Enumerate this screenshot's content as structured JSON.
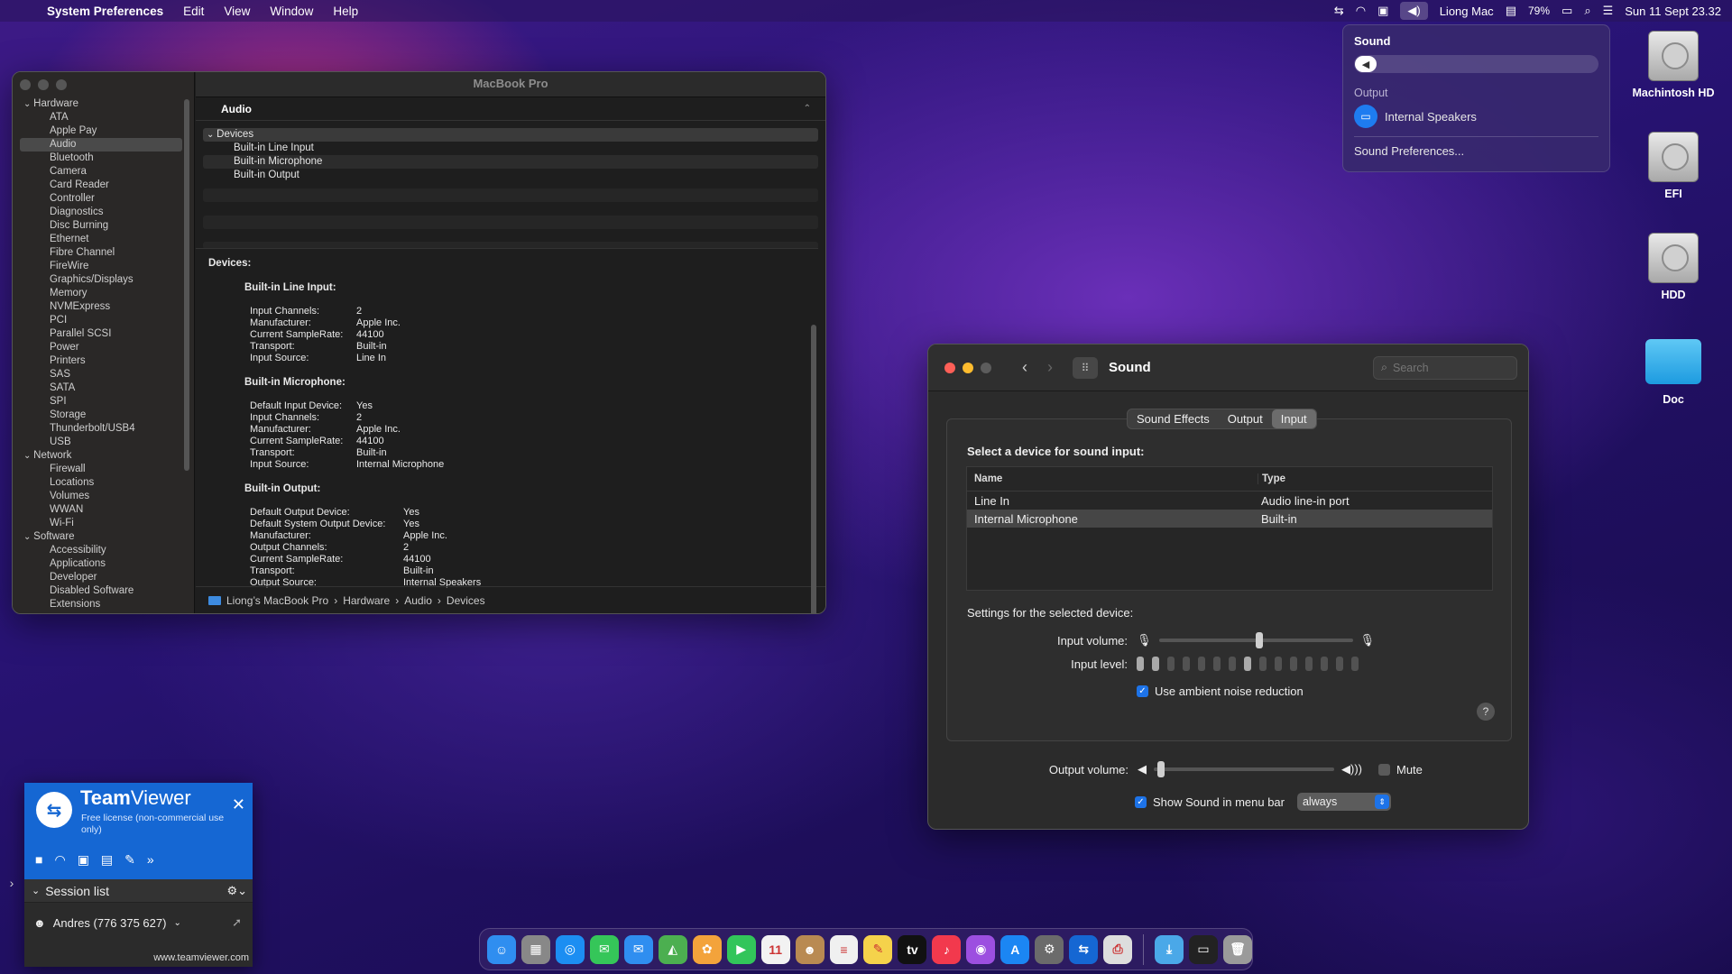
{
  "menubar": {
    "app_name": "System Preferences",
    "menus": [
      "Edit",
      "View",
      "Window",
      "Help"
    ],
    "user": "Liong Mac",
    "battery": "79%",
    "datetime": "Sun 11 Sept  23.32",
    "icons": [
      "apple-icon",
      "teamviewer-icon",
      "wifi-icon",
      "activity-icon",
      "volume-icon",
      "flag-icon",
      "battery-icon",
      "search-icon",
      "control-center-icon"
    ]
  },
  "sound_menu": {
    "title": "Sound",
    "volume_level": 0.02,
    "output_section": "Output",
    "output_device": "Internal Speakers",
    "preferences_link": "Sound Preferences..."
  },
  "desktop_icons": [
    "Machintosh HD",
    "EFI",
    "HDD",
    "Doc"
  ],
  "sysinfo": {
    "window_title": "MacBook Pro",
    "tree": [
      {
        "label": "Hardware",
        "kind": "cat"
      },
      {
        "label": "ATA"
      },
      {
        "label": "Apple Pay"
      },
      {
        "label": "Audio",
        "selected": true
      },
      {
        "label": "Bluetooth"
      },
      {
        "label": "Camera"
      },
      {
        "label": "Card Reader"
      },
      {
        "label": "Controller"
      },
      {
        "label": "Diagnostics"
      },
      {
        "label": "Disc Burning"
      },
      {
        "label": "Ethernet"
      },
      {
        "label": "Fibre Channel"
      },
      {
        "label": "FireWire"
      },
      {
        "label": "Graphics/Displays"
      },
      {
        "label": "Memory"
      },
      {
        "label": "NVMExpress"
      },
      {
        "label": "PCI"
      },
      {
        "label": "Parallel SCSI"
      },
      {
        "label": "Power"
      },
      {
        "label": "Printers"
      },
      {
        "label": "SAS"
      },
      {
        "label": "SATA"
      },
      {
        "label": "SPI"
      },
      {
        "label": "Storage"
      },
      {
        "label": "Thunderbolt/USB4"
      },
      {
        "label": "USB"
      },
      {
        "label": "Network",
        "kind": "cat"
      },
      {
        "label": "Firewall"
      },
      {
        "label": "Locations"
      },
      {
        "label": "Volumes"
      },
      {
        "label": "WWAN"
      },
      {
        "label": "Wi-Fi"
      },
      {
        "label": "Software",
        "kind": "cat"
      },
      {
        "label": "Accessibility"
      },
      {
        "label": "Applications"
      },
      {
        "label": "Developer"
      },
      {
        "label": "Disabled Software"
      },
      {
        "label": "Extensions"
      }
    ],
    "section": "Audio",
    "list_header": "Devices",
    "list_items": [
      "Built-in Line Input",
      "Built-in Microphone",
      "Built-in Output"
    ],
    "detail_heading": "Devices:",
    "devices": [
      {
        "name": "Built-in Line Input:",
        "wide": false,
        "props": [
          [
            "Input Channels:",
            "2"
          ],
          [
            "Manufacturer:",
            "Apple Inc."
          ],
          [
            "Current SampleRate:",
            "44100"
          ],
          [
            "Transport:",
            "Built-in"
          ],
          [
            "Input Source:",
            "Line In"
          ]
        ]
      },
      {
        "name": "Built-in Microphone:",
        "wide": false,
        "props": [
          [
            "Default Input Device:",
            "Yes"
          ],
          [
            "Input Channels:",
            "2"
          ],
          [
            "Manufacturer:",
            "Apple Inc."
          ],
          [
            "Current SampleRate:",
            "44100"
          ],
          [
            "Transport:",
            "Built-in"
          ],
          [
            "Input Source:",
            "Internal Microphone"
          ]
        ]
      },
      {
        "name": "Built-in Output:",
        "wide": true,
        "props": [
          [
            "Default Output Device:",
            "Yes"
          ],
          [
            "Default System Output Device:",
            "Yes"
          ],
          [
            "Manufacturer:",
            "Apple Inc."
          ],
          [
            "Output Channels:",
            "2"
          ],
          [
            "Current SampleRate:",
            "44100"
          ],
          [
            "Transport:",
            "Built-in"
          ],
          [
            "Output Source:",
            "Internal Speakers"
          ]
        ]
      }
    ],
    "breadcrumb": [
      "Liong’s MacBook Pro",
      "Hardware",
      "Audio",
      "Devices"
    ]
  },
  "sound_prefs": {
    "title": "Sound",
    "search_placeholder": "Search",
    "tabs": [
      "Sound Effects",
      "Output",
      "Input"
    ],
    "selected_tab": "Input",
    "lead": "Select a device for sound input:",
    "columns": [
      "Name",
      "Type"
    ],
    "devices": [
      {
        "name": "Line In",
        "type": "Audio line-in port",
        "selected": false
      },
      {
        "name": "Internal Microphone",
        "type": "Built-in",
        "selected": true
      }
    ],
    "settings_label": "Settings for the selected device:",
    "input_volume_label": "Input volume:",
    "input_volume": 0.5,
    "input_level_label": "Input level:",
    "input_level_lit": 2,
    "input_level_segments": 15,
    "ambient_label": "Use ambient noise reduction",
    "ambient_checked": true,
    "output_volume_label": "Output volume:",
    "output_volume": 0.02,
    "mute_label": "Mute",
    "show_sound_label": "Show Sound in menu bar",
    "show_sound_value": "always",
    "help": "?"
  },
  "teamviewer": {
    "brand_a": "Team",
    "brand_b": "Viewer",
    "license": "Free license (non-commercial use only)",
    "session_list": "Session list",
    "contact": "Andres (776 375 627)",
    "url": "www.teamviewer.com"
  },
  "dock": {
    "apps": [
      {
        "name": "finder",
        "color": "#2f8ef0",
        "glyph": "☺"
      },
      {
        "name": "launchpad",
        "color": "#888888",
        "glyph": "▦"
      },
      {
        "name": "safari",
        "color": "#1c8ef2",
        "glyph": "◎"
      },
      {
        "name": "messages",
        "color": "#35c659",
        "glyph": "✉"
      },
      {
        "name": "mail",
        "color": "#2f8ef0",
        "glyph": "✉"
      },
      {
        "name": "maps",
        "color": "#4caf50",
        "glyph": "◭"
      },
      {
        "name": "photos",
        "color": "#f3a33b",
        "glyph": "✿"
      },
      {
        "name": "facetime",
        "color": "#32c55a",
        "glyph": "▶"
      },
      {
        "name": "calendar",
        "color": "#f2f2f2",
        "glyph": "11"
      },
      {
        "name": "contacts",
        "color": "#b98a52",
        "glyph": "☻"
      },
      {
        "name": "reminders",
        "color": "#f0f0f0",
        "glyph": "≡"
      },
      {
        "name": "notes",
        "color": "#f5d24b",
        "glyph": "✎"
      },
      {
        "name": "tv",
        "color": "#111111",
        "glyph": "tv"
      },
      {
        "name": "music",
        "color": "#f2394d",
        "glyph": "♪"
      },
      {
        "name": "podcasts",
        "color": "#9c4fe0",
        "glyph": "◉"
      },
      {
        "name": "app-store",
        "color": "#1b86f3",
        "glyph": "A"
      },
      {
        "name": "system-preferences",
        "color": "#6b6b6b",
        "glyph": "⚙"
      },
      {
        "name": "teamviewer",
        "color": "#1567d3",
        "glyph": "⇆"
      },
      {
        "name": "printer",
        "color": "#dddddd",
        "glyph": "⎙"
      }
    ],
    "extras": [
      {
        "name": "downloads-folder",
        "color": "#4aa8e8",
        "glyph": "⤓"
      },
      {
        "name": "screenshot",
        "color": "#222222",
        "glyph": "▭"
      },
      {
        "name": "trash",
        "color": "#9a9a9a",
        "glyph": "🗑"
      }
    ]
  }
}
